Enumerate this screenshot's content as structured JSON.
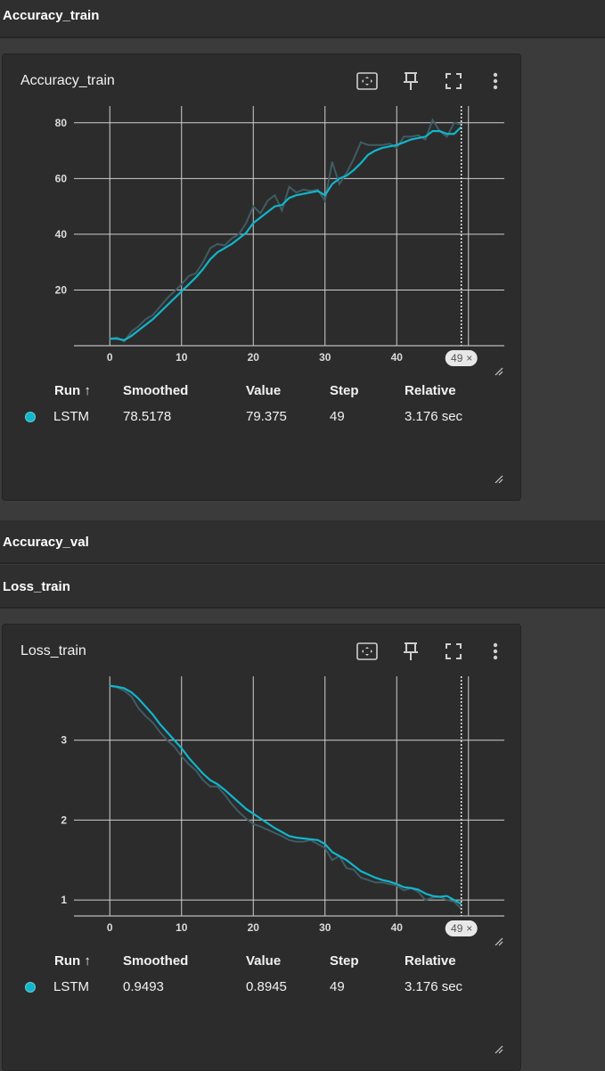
{
  "sections": [
    {
      "title": "Accuracy_train"
    },
    {
      "title": "Accuracy_val"
    },
    {
      "title": "Loss_train"
    }
  ],
  "colors": {
    "series": "#12b5cb",
    "raw": "#3f5c63",
    "grid": "#cfcfcf",
    "axis": "#bdbdbd"
  },
  "icons": [
    "fit-domain-icon",
    "pin-icon",
    "fullscreen-icon",
    "more-vert-icon"
  ],
  "cards": [
    {
      "title": "Accuracy_train",
      "cursor_badge": "49",
      "table": {
        "headers": {
          "run": "Run ↑",
          "smoothed": "Smoothed",
          "value": "Value",
          "step": "Step",
          "relative": "Relative"
        },
        "rows": [
          {
            "run": "LSTM",
            "smoothed": "78.5178",
            "value": "79.375",
            "step": "49",
            "relative": "3.176 sec"
          }
        ]
      }
    },
    {
      "title": "Loss_train",
      "cursor_badge": "49",
      "table": {
        "headers": {
          "run": "Run ↑",
          "smoothed": "Smoothed",
          "value": "Value",
          "step": "Step",
          "relative": "Relative"
        },
        "rows": [
          {
            "run": "LSTM",
            "smoothed": "0.9493",
            "value": "0.8945",
            "step": "49",
            "relative": "3.176 sec"
          }
        ]
      }
    }
  ],
  "chart_data": [
    {
      "type": "line",
      "title": "Accuracy_train",
      "xlim": [
        -5,
        55
      ],
      "ylim": [
        0,
        86
      ],
      "xticks": [
        0,
        10,
        20,
        30,
        40
      ],
      "yticks": [
        20,
        40,
        60,
        80
      ],
      "grid": true,
      "cursor_x": 49,
      "series": [
        {
          "name": "LSTM",
          "x": [
            0,
            1,
            2,
            3,
            4,
            5,
            6,
            7,
            8,
            9,
            10,
            11,
            12,
            13,
            14,
            15,
            16,
            17,
            18,
            19,
            20,
            21,
            22,
            23,
            24,
            25,
            26,
            27,
            28,
            29,
            30,
            31,
            32,
            33,
            34,
            35,
            36,
            37,
            38,
            39,
            40,
            41,
            42,
            43,
            44,
            45,
            46,
            47,
            48,
            49
          ],
          "smoothed": [
            2.5,
            2.5,
            2.0,
            3.5,
            5.5,
            7.5,
            9.5,
            12,
            14.5,
            17,
            19.5,
            22,
            24.5,
            27.5,
            31,
            33.5,
            35,
            36.5,
            38.5,
            40.5,
            44,
            46,
            48,
            50,
            50.5,
            53,
            54,
            54.5,
            55,
            55.5,
            54,
            58,
            60,
            61,
            63,
            65.5,
            68.5,
            70,
            71,
            71.5,
            72,
            73,
            74,
            74.5,
            75,
            77,
            77,
            76,
            76,
            78.5
          ],
          "raw": [
            2.5,
            3,
            1.5,
            5,
            7,
            9.5,
            11,
            14,
            17,
            19.5,
            22,
            25,
            26,
            30,
            35,
            36.5,
            36,
            38.5,
            40,
            44,
            50,
            47.5,
            52,
            54,
            48.5,
            57,
            55,
            56,
            55.5,
            56,
            52,
            66,
            58,
            62,
            67,
            73,
            72,
            72,
            72,
            72.5,
            71,
            75,
            75,
            75.5,
            74,
            81,
            77,
            75,
            80,
            79.4
          ]
        }
      ]
    },
    {
      "type": "line",
      "title": "Loss_train",
      "ylim": [
        0.8,
        3.8
      ],
      "xlim": [
        -5,
        55
      ],
      "xticks": [
        0,
        10,
        20,
        30,
        40
      ],
      "yticks": [
        1,
        2,
        3
      ],
      "grid": true,
      "cursor_x": 49,
      "series": [
        {
          "name": "LSTM",
          "x": [
            0,
            1,
            2,
            3,
            4,
            5,
            6,
            7,
            8,
            9,
            10,
            11,
            12,
            13,
            14,
            15,
            16,
            17,
            18,
            19,
            20,
            21,
            22,
            23,
            24,
            25,
            26,
            27,
            28,
            29,
            30,
            31,
            32,
            33,
            34,
            35,
            36,
            37,
            38,
            39,
            40,
            41,
            42,
            43,
            44,
            45,
            46,
            47,
            48,
            49
          ],
          "smoothed": [
            3.68,
            3.67,
            3.65,
            3.6,
            3.52,
            3.42,
            3.32,
            3.2,
            3.1,
            3.0,
            2.9,
            2.78,
            2.68,
            2.58,
            2.5,
            2.45,
            2.38,
            2.3,
            2.22,
            2.14,
            2.08,
            2.02,
            1.96,
            1.9,
            1.85,
            1.8,
            1.78,
            1.77,
            1.76,
            1.75,
            1.7,
            1.6,
            1.55,
            1.5,
            1.43,
            1.36,
            1.32,
            1.28,
            1.25,
            1.23,
            1.2,
            1.16,
            1.15,
            1.13,
            1.08,
            1.05,
            1.04,
            1.05,
            1.0,
            0.95
          ],
          "raw": [
            3.68,
            3.66,
            3.62,
            3.55,
            3.4,
            3.3,
            3.22,
            3.1,
            3.0,
            2.92,
            2.8,
            2.7,
            2.62,
            2.5,
            2.42,
            2.42,
            2.32,
            2.2,
            2.1,
            2.02,
            1.95,
            1.92,
            1.88,
            1.84,
            1.8,
            1.75,
            1.73,
            1.73,
            1.75,
            1.7,
            1.65,
            1.5,
            1.55,
            1.4,
            1.38,
            1.28,
            1.25,
            1.22,
            1.22,
            1.2,
            1.18,
            1.12,
            1.15,
            1.1,
            1.0,
            1.03,
            1.04,
            1.0,
            0.98,
            0.89
          ]
        }
      ]
    }
  ]
}
